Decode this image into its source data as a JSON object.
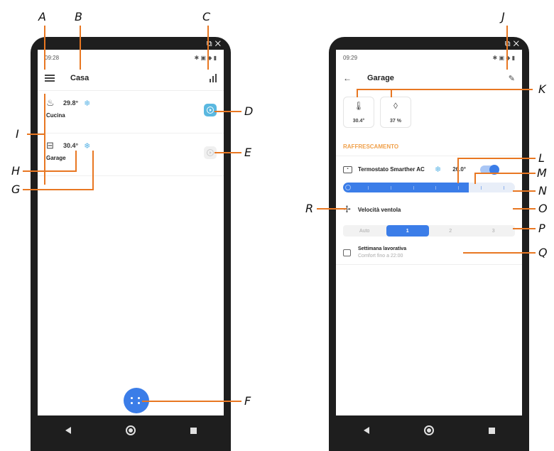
{
  "left": {
    "status_time": "09:28",
    "title": "Casa",
    "rooms": [
      {
        "icon": "stove-icon",
        "temp": "29.8°",
        "name": "Cucina",
        "active": true
      },
      {
        "icon": "garage-icon",
        "temp": "30.4°",
        "name": "Garage",
        "active": false
      }
    ]
  },
  "right": {
    "status_time": "09:29",
    "title": "Garage",
    "sensors": [
      {
        "icon": "thermometer-icon",
        "value": "30.4°"
      },
      {
        "icon": "humidity-drop-icon",
        "value": "37 %"
      }
    ],
    "section_title": "RAFFRESCAMENTO",
    "thermostat_name": "Termostato Smarther AC",
    "setpoint": "26.0°",
    "toggle_on": true,
    "slider_level_percent": 73,
    "fan_label": "Velocità ventola",
    "fan_speeds": [
      "Auto",
      "1",
      "2",
      "3"
    ],
    "fan_speed_selected": "1",
    "schedule_title": "Settimana lavorativa",
    "schedule_sub": "Comfort fino a 22:00"
  },
  "callouts": [
    "A",
    "B",
    "C",
    "D",
    "E",
    "F",
    "G",
    "H",
    "I",
    "J",
    "K",
    "L",
    "M",
    "N",
    "O",
    "P",
    "Q",
    "R"
  ],
  "accent_color": "#3b7de8",
  "callout_line_color": "#e87722"
}
